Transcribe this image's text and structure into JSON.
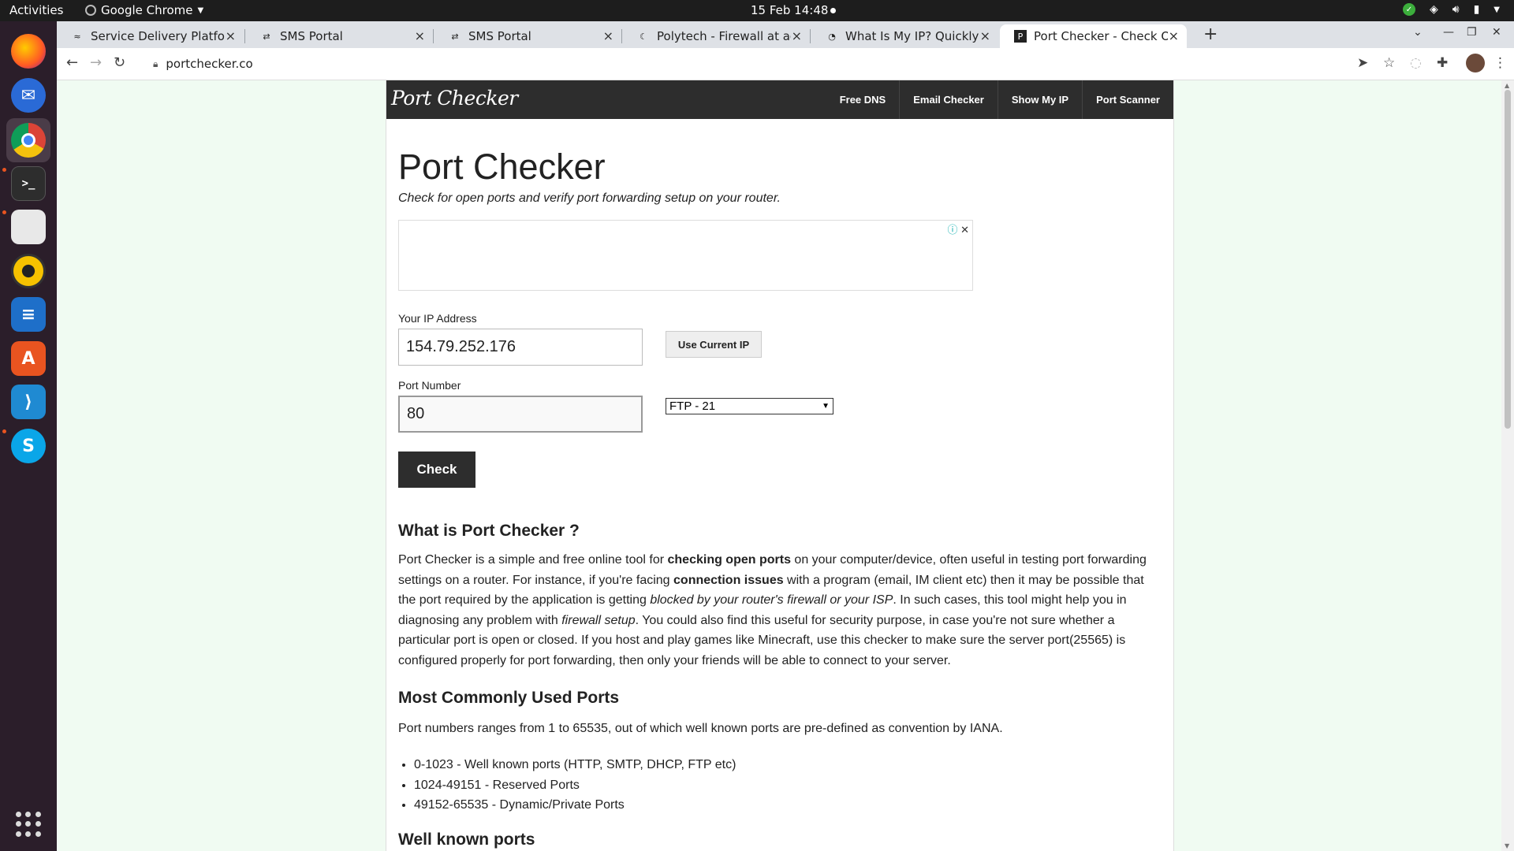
{
  "os": {
    "activities": "Activities",
    "app_name": "Google Chrome",
    "clock": "15 Feb  14:48"
  },
  "browser": {
    "tabs": [
      {
        "title": "Service Delivery Platform",
        "fav": "≈",
        "active": false
      },
      {
        "title": "SMS Portal",
        "fav": "⇄",
        "active": false
      },
      {
        "title": "SMS Portal",
        "fav": "⇄",
        "active": false
      },
      {
        "title": "Polytech - Firewall at adm",
        "fav": "☾",
        "active": false
      },
      {
        "title": "What Is My IP? Quickly Se",
        "fav": "◔",
        "active": false
      },
      {
        "title": "Port Checker - Check Oper",
        "fav": "P",
        "active": true
      }
    ],
    "url": "portchecker.co"
  },
  "site": {
    "logo": "Port Checker",
    "nav": [
      "Free DNS",
      "Email Checker",
      "Show My IP",
      "Port Scanner"
    ],
    "title": "Port Checker",
    "subtitle": "Check for open ports and verify port forwarding setup on your router.",
    "ip_label": "Your IP Address",
    "ip_value": "154.79.252.176",
    "use_current_ip": "Use Current IP",
    "port_label": "Port Number",
    "port_value": "80",
    "port_preset": "FTP - 21",
    "check_button": "Check",
    "what_heading": "What is Port Checker ?",
    "what_para": {
      "t1": "Port Checker is a simple and free online tool for ",
      "b1": "checking open ports",
      "t2": " on your computer/device, often useful in testing port forwarding settings on a router. For instance, if you're facing ",
      "b2": "connection issues",
      "t3": " with a program (email, IM client etc) then it may be possible that the port required by the application is getting ",
      "i1": "blocked by your router's firewall or your ISP",
      "t4": ". In such cases, this tool might help you in diagnosing any problem with ",
      "i2": "firewall setup",
      "t5": ". You could also find this useful for security purpose, in case you're not sure whether a particular port is open or closed. If you host and play games like Minecraft, use this checker to make sure the server port(25565) is configured properly for port forwarding, then only your friends will be able to connect to your server."
    },
    "common_heading": "Most Commonly Used Ports",
    "common_para": "Port numbers ranges from 1 to 65535, out of which well known ports are pre-defined as convention by IANA.",
    "port_ranges": [
      "0-1023 - Well known ports (HTTP, SMTP, DHCP, FTP etc)",
      "1024-49151 - Reserved Ports",
      "49152-65535 - Dynamic/Private Ports"
    ],
    "well_known_heading": "Well known ports"
  },
  "colors": {
    "page_bg": "#f0fbf2",
    "nav_bg": "#2d2d2d",
    "dock_bg": "#2b1e2a"
  }
}
